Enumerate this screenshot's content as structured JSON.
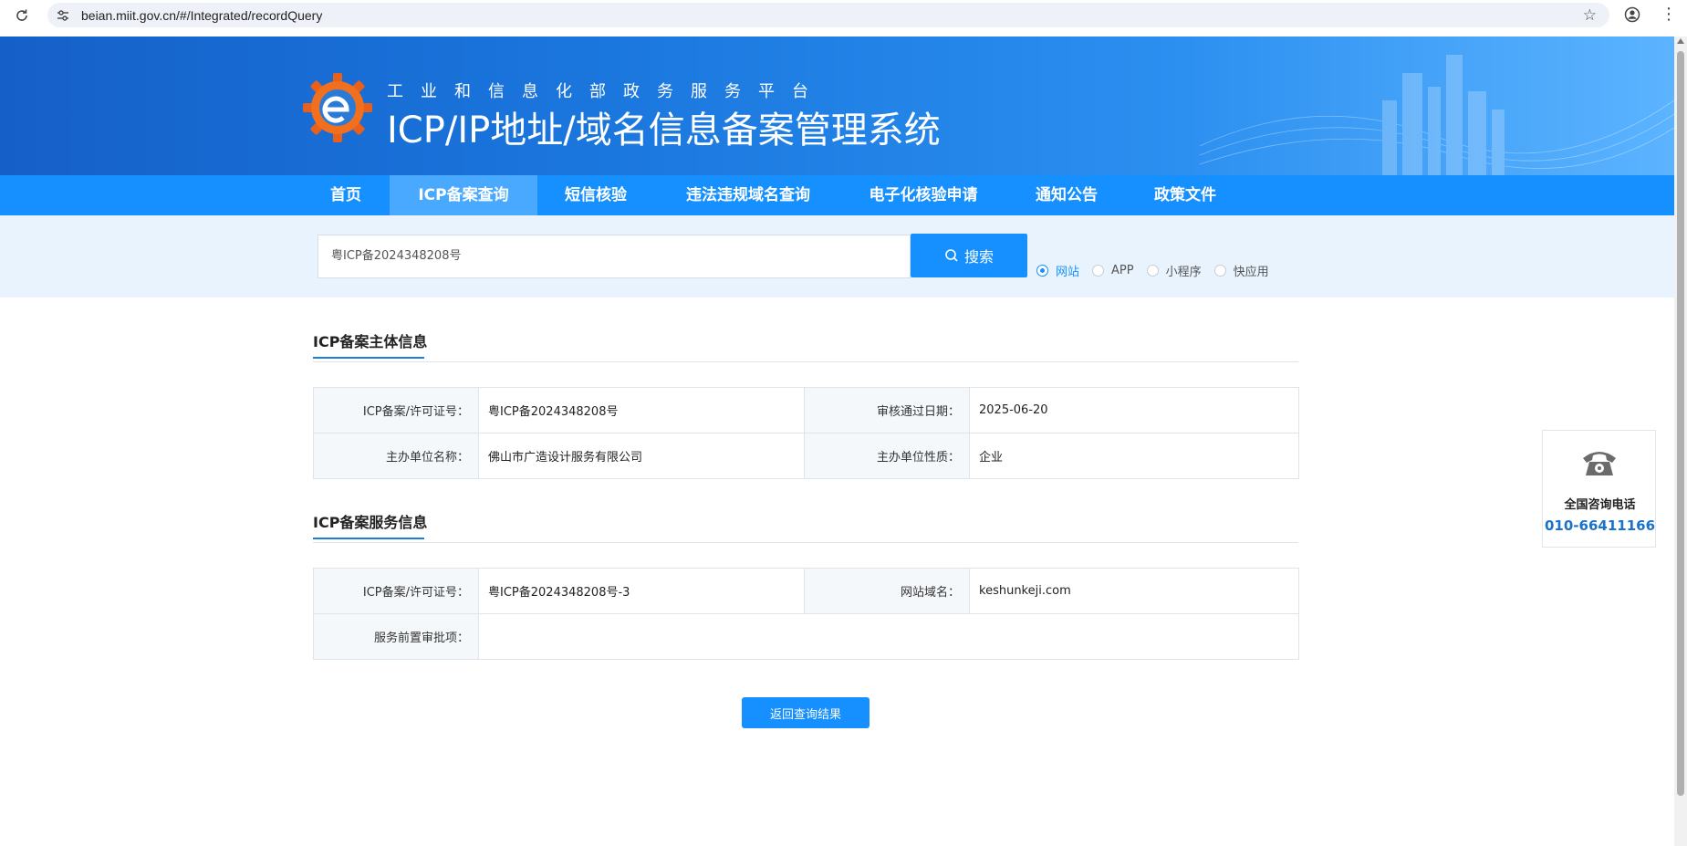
{
  "browser": {
    "url": "beian.miit.gov.cn/#/Integrated/recordQuery",
    "icons": [
      "reload-icon",
      "site-info-icon",
      "star-icon",
      "profile-icon",
      "menu-icon"
    ]
  },
  "header": {
    "subtitle": "工业和信息化部政务服务平台",
    "title": "ICP/IP地址/域名信息备案管理系统"
  },
  "nav": {
    "items": [
      {
        "label": "首页"
      },
      {
        "label": "ICP备案查询",
        "active": true
      },
      {
        "label": "短信核验"
      },
      {
        "label": "违法违规域名查询"
      },
      {
        "label": "电子化核验申请"
      },
      {
        "label": "通知公告"
      },
      {
        "label": "政策文件"
      }
    ]
  },
  "search": {
    "value": "粤ICP备2024348208号",
    "button_label": "搜索",
    "options": [
      {
        "label": "网站",
        "checked": true
      },
      {
        "label": "APP",
        "checked": false
      },
      {
        "label": "小程序",
        "checked": false
      },
      {
        "label": "快应用",
        "checked": false
      }
    ]
  },
  "subject_section": {
    "title": "ICP备案主体信息",
    "rows": [
      {
        "k1": "ICP备案/许可证号：",
        "v1": "粤ICP备2024348208号",
        "k2": "审核通过日期：",
        "v2": "2025-06-20"
      },
      {
        "k1": "主办单位名称：",
        "v1": "佛山市广造设计服务有限公司",
        "k2": "主办单位性质：",
        "v2": "企业"
      }
    ]
  },
  "service_section": {
    "title": "ICP备案服务信息",
    "row1": {
      "k1": "ICP备案/许可证号：",
      "v1": "粤ICP备2024348208号-3",
      "k2": "网站域名：",
      "v2": "keshunkeji.com"
    },
    "row2": {
      "k1": "服务前置审批项：",
      "v1": ""
    }
  },
  "return_button": "返回查询结果",
  "consult": {
    "label": "全国咨询电话",
    "phone": "010-66411166"
  },
  "colors": {
    "primary": "#1690ff",
    "nav_active": "#49a9ff",
    "search_bg": "#e8f3fd",
    "phone_text": "#1a73c8"
  }
}
